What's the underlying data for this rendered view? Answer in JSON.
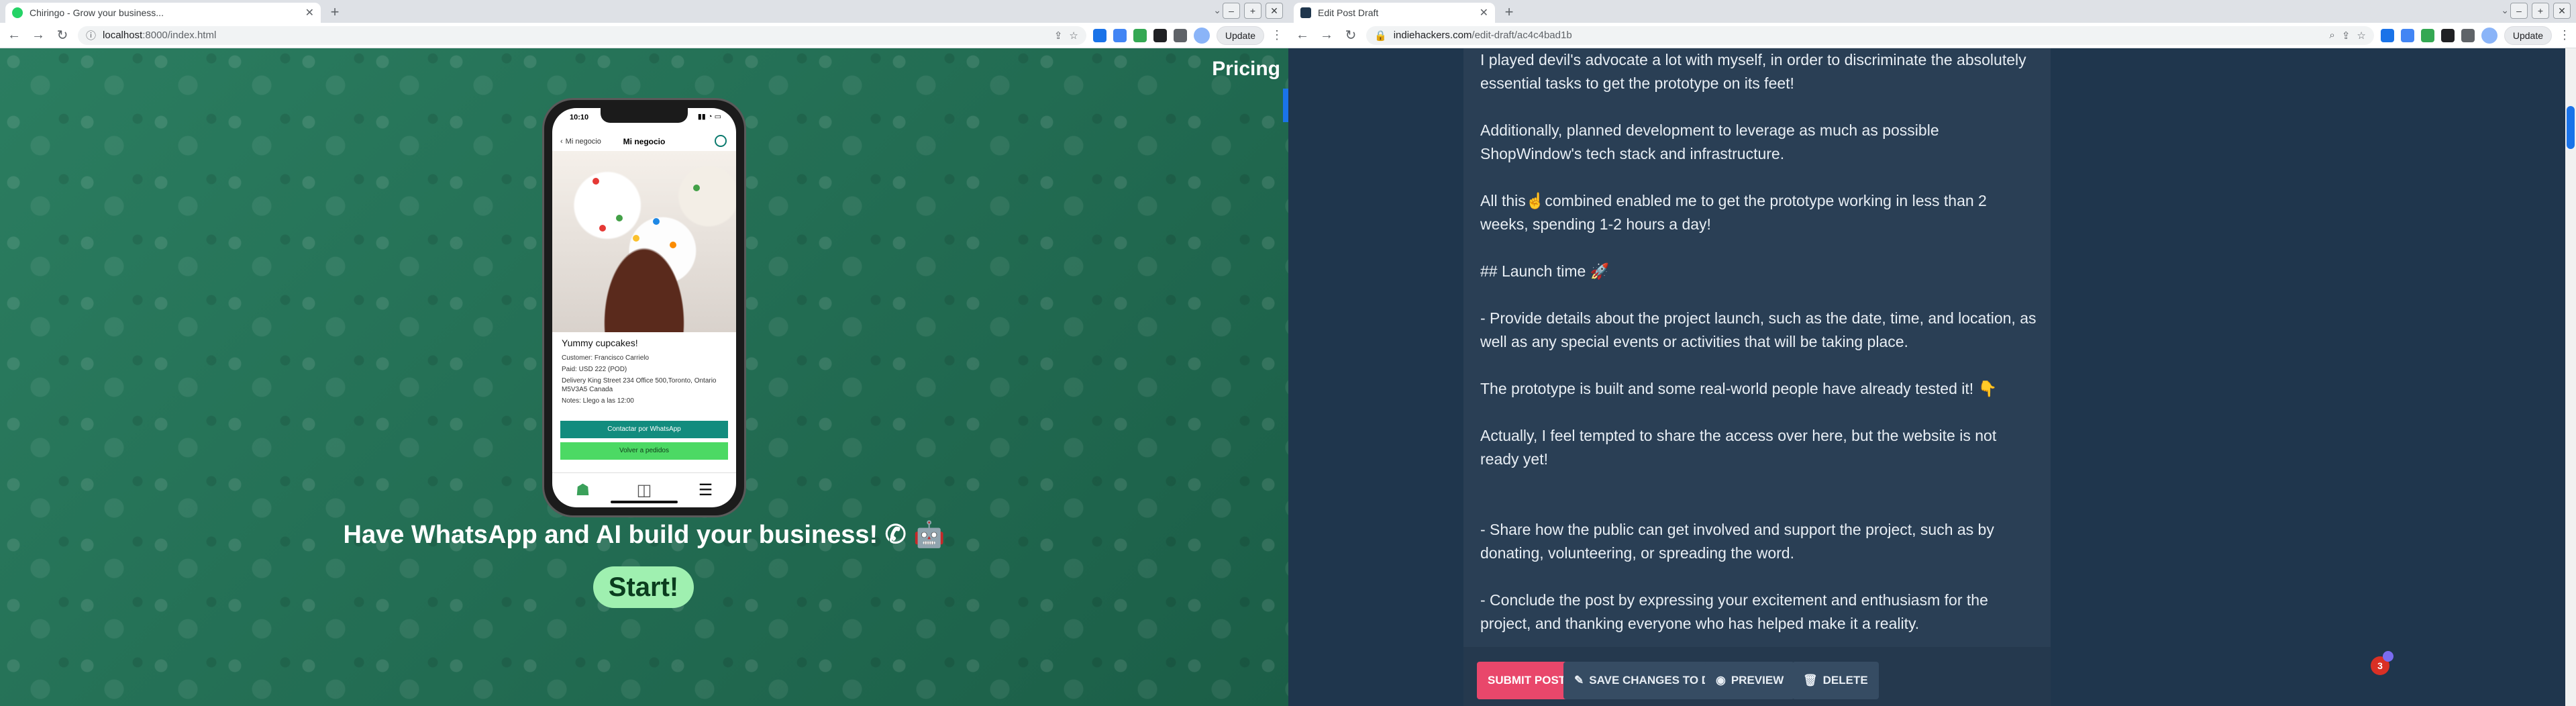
{
  "left": {
    "tab_title": "Chiringo - Grow your business...",
    "url_host": "localhost",
    "url_path": ":8000/index.html",
    "update_label": "Update",
    "pricing": "Pricing",
    "phone": {
      "time": "10:10",
      "back": "Mi negocio",
      "title": "Mi negocio",
      "product": "Yummy cupcakes!",
      "customer": "Customer: Francisco Carrielo",
      "paid": "Paid: USD 222 (POD)",
      "delivery": "Delivery King Street 234 Office 500,Toronto, Ontario M5V3A5 Canada",
      "notes": "Notes: Llego a las 12:00",
      "btn_contact": "Contactar por WhatsApp",
      "btn_back": "Volver a pedidos"
    },
    "tagline": "Have WhatsApp and AI build your business! ",
    "start": "Start!"
  },
  "right": {
    "tab_title": "Edit Post Draft",
    "url_host": "indiehackers.com",
    "url_path": "/edit-draft/ac4c4bad1b",
    "update_label": "Update",
    "post": {
      "p1": "I played devil's advocate a lot with myself, in order to discriminate the absolutely essential tasks to get the prototype on its feet!",
      "p2": "Additionally, planned development to leverage as much as possible ShopWindow's tech stack and infrastructure.",
      "p3": "All this☝️combined enabled me to get the prototype working in less than 2 weeks, spending 1-2 hours a day!",
      "p4": "## Launch time 🚀",
      "p5": " - Provide details about the project launch, such as the date, time, and location, as well as any special events or activities that will be taking place.",
      "p6": "The prototype is built and some real-world people have already tested it! 👇",
      "p7": "Actually, I feel tempted to share the access over here, but the website is not ready yet!",
      "p8": "- Share how the public can get involved and support the project, such as by donating, volunteering, or spreading the word.",
      "p9": "- Conclude the post by expressing your excitement and enthusiasm for the project, and thanking everyone who has helped make it a reality."
    },
    "buttons": {
      "submit": "SUBMIT POST",
      "save": "SAVE CHANGES TO DRAFT",
      "preview": "PREVIEW",
      "delete": "DELETE"
    },
    "badge": "3"
  },
  "colors": {
    "whatsapp_green": "#1e6b52",
    "ih_bg": "#1f364d",
    "submit": "#e9476b"
  }
}
